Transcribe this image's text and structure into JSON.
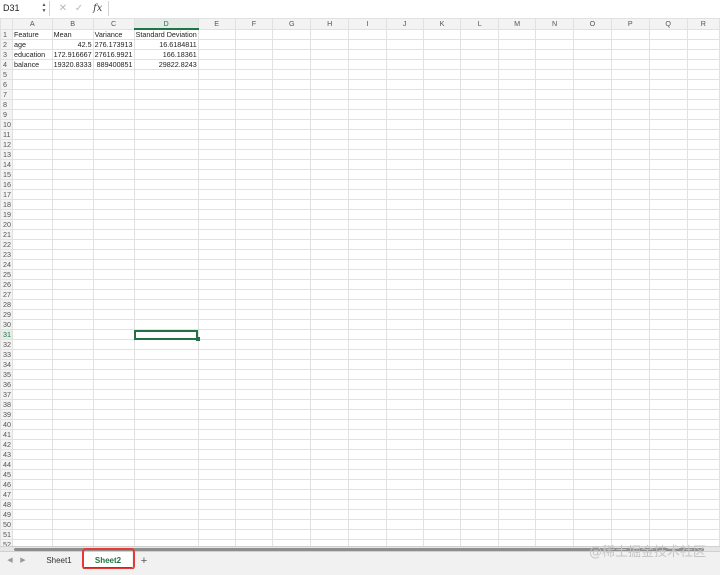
{
  "formula_bar": {
    "name_box": "D31",
    "cancel_icon": "✕",
    "enter_icon": "✓",
    "fx_label": "fx",
    "formula": ""
  },
  "columns": [
    "A",
    "B",
    "C",
    "D",
    "E",
    "F",
    "G",
    "H",
    "I",
    "J",
    "K",
    "L",
    "M",
    "N",
    "O",
    "P",
    "Q",
    "R"
  ],
  "cells": [
    [
      "Feature",
      "Mean",
      "Variance",
      "Standard Deviation"
    ],
    [
      "age",
      "42.5",
      "276.173913",
      "16.6184811"
    ],
    [
      "education",
      "172.916667",
      "27616.9921",
      "166.18361"
    ],
    [
      "balance",
      "19320.8333",
      "889400851",
      "29822.8243"
    ]
  ],
  "row_count": 53,
  "selected_cell": {
    "column": "D",
    "row": 31
  },
  "sheets": [
    "Sheet1",
    "Sheet2"
  ],
  "active_sheet": "Sheet2",
  "colors": {
    "accent": "#217346",
    "highlight": "#e53935"
  },
  "watermark": "@稀土掘金技术社区"
}
